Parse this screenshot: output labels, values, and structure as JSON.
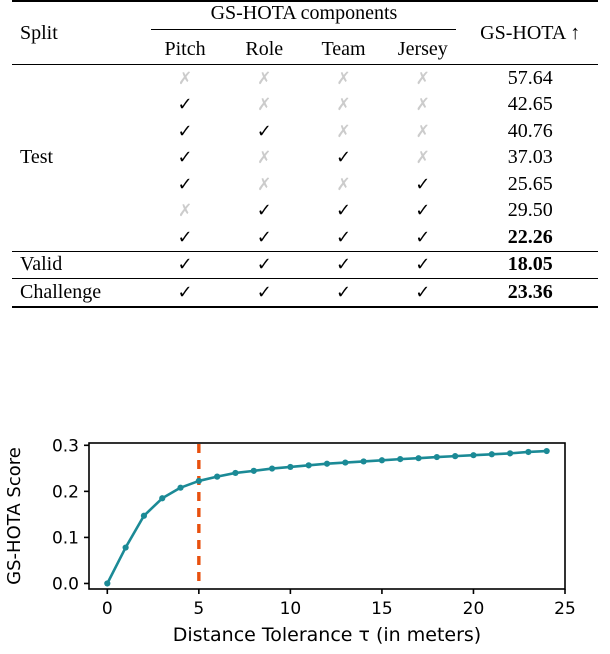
{
  "table": {
    "header": {
      "split": "Split",
      "group": "GS-HOTA components",
      "metric": "GS-HOTA ↑",
      "components": [
        "Pitch",
        "Role",
        "Team",
        "Jersey"
      ]
    },
    "marks": {
      "yes": "✓",
      "no": "✗"
    },
    "sections": [
      {
        "label": "Test",
        "rows": [
          {
            "flags": [
              false,
              false,
              false,
              false
            ],
            "value": "57.64",
            "bold": false
          },
          {
            "flags": [
              true,
              false,
              false,
              false
            ],
            "value": "42.65",
            "bold": false
          },
          {
            "flags": [
              true,
              true,
              false,
              false
            ],
            "value": "40.76",
            "bold": false
          },
          {
            "flags": [
              true,
              false,
              true,
              false
            ],
            "value": "37.03",
            "bold": false
          },
          {
            "flags": [
              true,
              false,
              false,
              true
            ],
            "value": "25.65",
            "bold": false
          },
          {
            "flags": [
              false,
              true,
              true,
              true
            ],
            "value": "29.50",
            "bold": false
          },
          {
            "flags": [
              true,
              true,
              true,
              true
            ],
            "value": "22.26",
            "bold": true
          }
        ]
      },
      {
        "label": "Valid",
        "rows": [
          {
            "flags": [
              true,
              true,
              true,
              true
            ],
            "value": "18.05",
            "bold": true
          }
        ]
      },
      {
        "label": "Challenge",
        "rows": [
          {
            "flags": [
              true,
              true,
              true,
              true
            ],
            "value": "23.36",
            "bold": true
          }
        ]
      }
    ]
  },
  "chart_data": {
    "type": "line",
    "title": "",
    "xlabel": "Distance Tolerance τ (in meters)",
    "ylabel": "GS-HOTA Score",
    "xlim": [
      -1,
      25
    ],
    "ylim": [
      -0.012,
      0.305
    ],
    "xticks": [
      0,
      5,
      10,
      15,
      20,
      25
    ],
    "xticklabels": [
      "0",
      "5",
      "10",
      "15",
      "20",
      "25"
    ],
    "yticks": [
      0.0,
      0.1,
      0.2,
      0.3
    ],
    "yticklabels": [
      "0.0",
      "0.1",
      "0.2",
      "0.3"
    ],
    "grid": false,
    "legend": null,
    "line_color": "#1b8a96",
    "marker": "o",
    "x": [
      0,
      1,
      2,
      3,
      4,
      5,
      6,
      7,
      8,
      9,
      10,
      11,
      12,
      13,
      14,
      15,
      16,
      17,
      18,
      19,
      20,
      21,
      22,
      23,
      24
    ],
    "y": [
      0.0,
      0.078,
      0.147,
      0.185,
      0.208,
      0.2226,
      0.232,
      0.24,
      0.2445,
      0.2495,
      0.253,
      0.2565,
      0.26,
      0.2625,
      0.265,
      0.2675,
      0.27,
      0.272,
      0.2745,
      0.2765,
      0.2785,
      0.2805,
      0.2825,
      0.2855,
      0.2875
    ],
    "annotations": [
      {
        "type": "vline",
        "x": 5,
        "color": "#e8500e",
        "style": "dashed",
        "label": ""
      }
    ]
  }
}
